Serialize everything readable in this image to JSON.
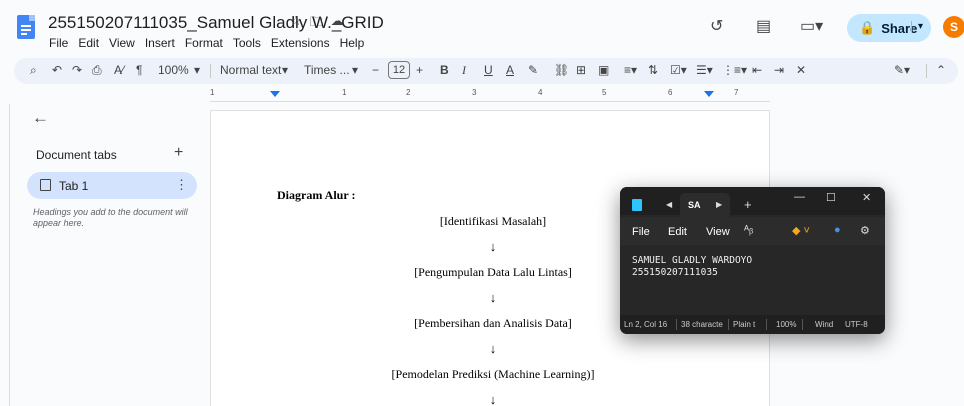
{
  "header": {
    "doc_title": "255150207111035_Samuel Gladly W._GRID",
    "title_icons": [
      "star-icon",
      "move-to-folder-icon",
      "cloud-saved-icon"
    ],
    "menu": [
      "File",
      "Edit",
      "View",
      "Insert",
      "Format",
      "Tools",
      "Extensions",
      "Help"
    ],
    "share_label": "Share",
    "avatar_initial": "S"
  },
  "toolbar": {
    "zoom": "100%",
    "style": "Normal text",
    "font": "Times ...",
    "font_size": "12",
    "bold": "B",
    "italic": "I",
    "underline": "U",
    "text_color": "A"
  },
  "ruler": {
    "labels": [
      "1",
      "1",
      "2",
      "3",
      "4",
      "5",
      "6",
      "7"
    ]
  },
  "sidebar": {
    "heading": "Document tabs",
    "tab_label": "Tab 1",
    "note": "Headings you add to the document will appear here."
  },
  "document": {
    "flow_title": "Diagram Alur :",
    "steps": [
      "[Identifikasi Masalah]",
      "[Pengumpulan Data Lalu Lintas]",
      "[Pembersihan dan Analisis Data]",
      "[Pemodelan Prediksi (Machine Learning)]"
    ],
    "arrow": "↓"
  },
  "notepad": {
    "tab_title": "SA",
    "menu": [
      "File",
      "Edit",
      "View"
    ],
    "lines": [
      "SAMUEL GLADLY WARDOYO",
      "255150207111035"
    ],
    "status": {
      "position": "Ln 2, Col 16",
      "chars": "38 characte",
      "format": "Plain t",
      "zoom": "100%",
      "line_ending": "Wind",
      "encoding": "UTF-8"
    }
  },
  "colors": {
    "share_bg": "#c2e7ff",
    "tab_active_bg": "#d3e3fd",
    "doc_icon": "#4285f4",
    "avatar_bg": "#f57c00",
    "notepad_bg": "#272727"
  }
}
